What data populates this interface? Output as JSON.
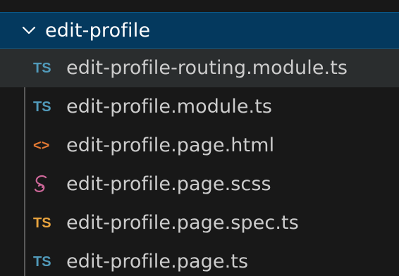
{
  "folder": {
    "label": "edit-profile",
    "expanded": true,
    "icon": "chevron-down-icon"
  },
  "files": [
    {
      "label": "edit-profile-routing.module.ts",
      "icon": "typescript-icon",
      "icon_text": "TS",
      "icon_color": "#519aba",
      "hovered": true
    },
    {
      "label": "edit-profile.module.ts",
      "icon": "typescript-icon",
      "icon_text": "TS",
      "icon_color": "#519aba",
      "hovered": false
    },
    {
      "label": "edit-profile.page.html",
      "icon": "html-icon",
      "icon_text": "<>",
      "icon_color": "#e37933",
      "hovered": false
    },
    {
      "label": "edit-profile.page.scss",
      "icon": "sass-icon",
      "icon_text": "",
      "icon_color": "#cd6799",
      "hovered": false
    },
    {
      "label": "edit-profile.page.spec.ts",
      "icon": "typescript-spec-icon",
      "icon_text": "TS",
      "icon_color": "#e8a33e",
      "hovered": false
    },
    {
      "label": "edit-profile.page.ts",
      "icon": "typescript-icon",
      "icon_text": "TS",
      "icon_color": "#519aba",
      "hovered": false
    }
  ],
  "colors": {
    "background": "#181818",
    "selected_folder": "#04395e",
    "text": "#cccccc",
    "hover_row": "#2a2d2e"
  }
}
